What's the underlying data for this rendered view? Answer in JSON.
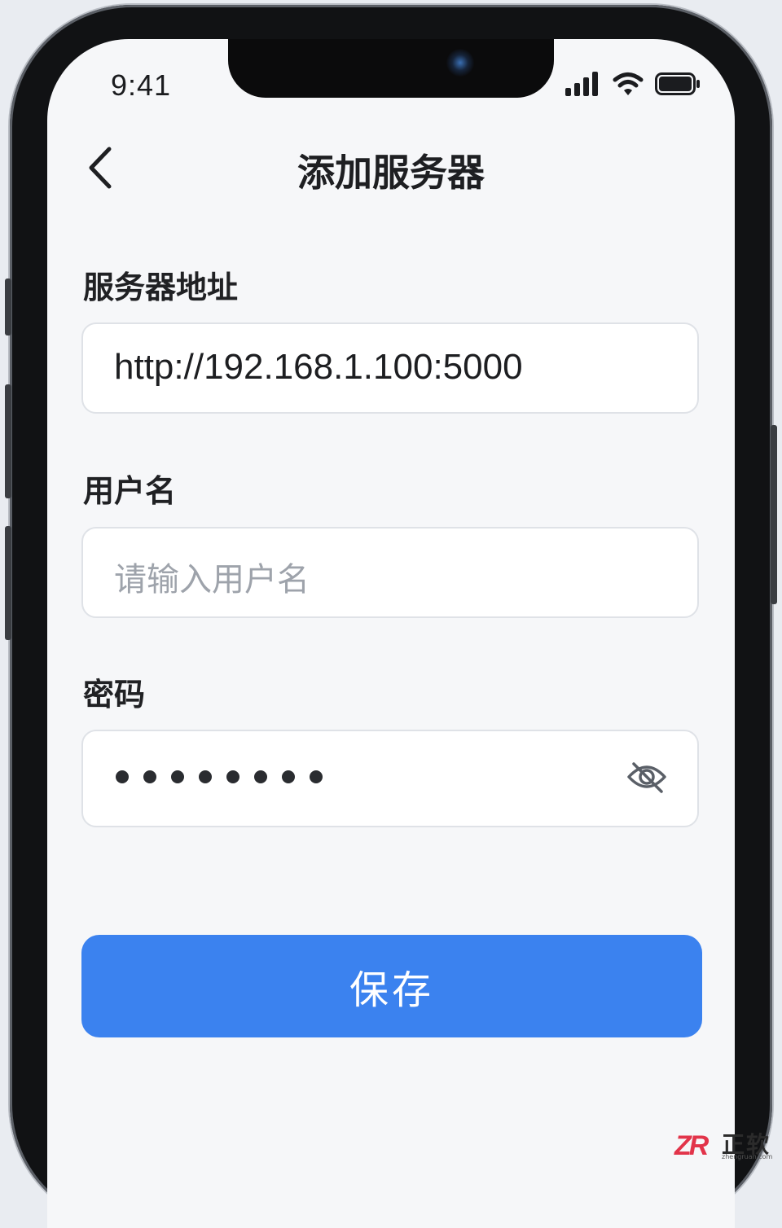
{
  "status_bar": {
    "time": "9:41",
    "signal_icon": "cellular-signal-icon",
    "wifi_icon": "wifi-icon",
    "battery_icon": "battery-icon"
  },
  "header": {
    "back_icon": "chevron-left-icon",
    "title": "添加服务器"
  },
  "form": {
    "server_address": {
      "label": "服务器地址",
      "value": "http://192.168.1.100:5000"
    },
    "username": {
      "label": "用户名",
      "value": "",
      "placeholder": "请输入用户名"
    },
    "password": {
      "label": "密码",
      "masked_length": 8,
      "visibility_icon": "eye-off-icon"
    },
    "save_label": "保存"
  },
  "colors": {
    "accent": "#3b82ef",
    "background": "#f6f7f9",
    "field_border": "#dfe2e7",
    "placeholder": "#9ea3ab"
  },
  "watermark": {
    "logo": "ZR",
    "text": "正软",
    "sub": "zhengruan.com"
  }
}
